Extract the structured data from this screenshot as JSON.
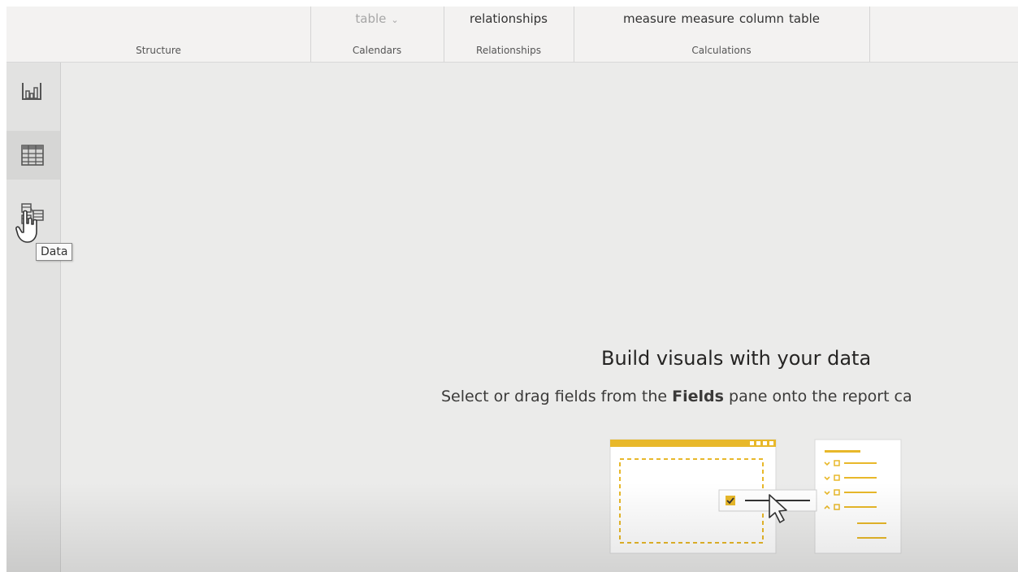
{
  "ribbon": {
    "structure": {
      "label": "Structure"
    },
    "calendars": {
      "item": "table",
      "label": "Calendars"
    },
    "relationships": {
      "item": "relationships",
      "label": "Relationships"
    },
    "calculations": {
      "items": [
        "measure",
        "measure",
        "column",
        "table"
      ],
      "label": "Calculations"
    }
  },
  "rail": {
    "views": [
      {
        "icon": "report-view-icon"
      },
      {
        "icon": "data-view-icon",
        "selected": true
      },
      {
        "icon": "model-view-icon"
      }
    ],
    "tooltip": "Data"
  },
  "canvas": {
    "title": "Build visuals with your data",
    "subtitle_pre": "Select or drag fields from the ",
    "subtitle_bold": "Fields",
    "subtitle_post": " pane onto the report ca"
  },
  "colors": {
    "accent": "#e8b82a",
    "background": "#ebebea",
    "ribbon": "#f3f2f1"
  }
}
